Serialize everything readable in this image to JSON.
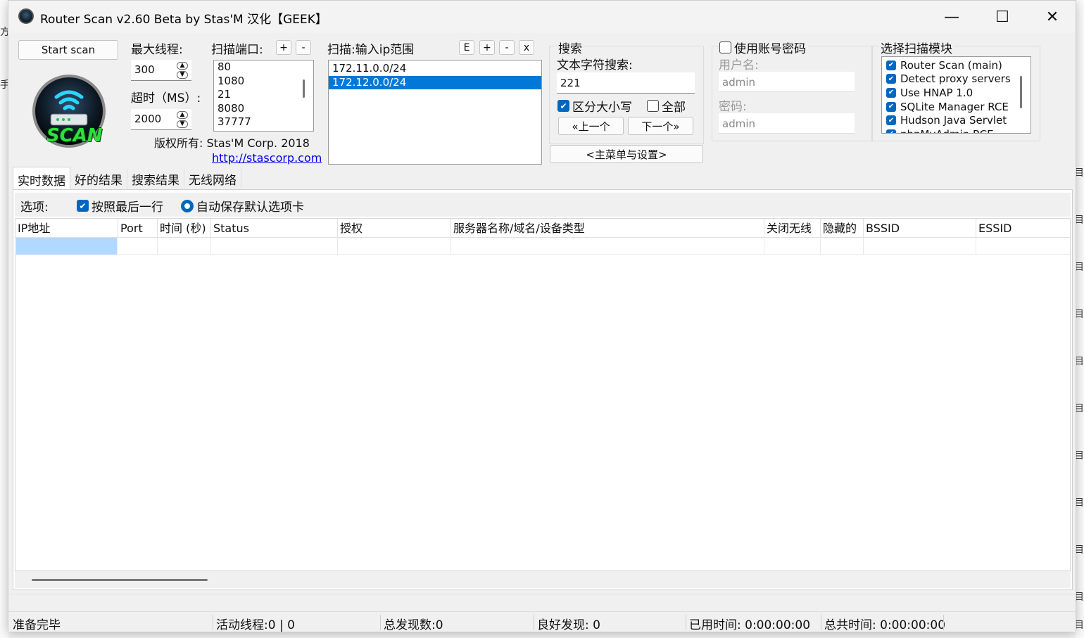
{
  "window": {
    "title": "Router Scan v2.60 Beta by Stas'M  汉化【GEEK】",
    "minimize_glyph": "—",
    "maximize_glyph": "☐",
    "close_glyph": "✕"
  },
  "background": {
    "left_glyphs": [
      "方",
      "手"
    ],
    "right_glyphs": [
      "目",
      "目",
      "目",
      "目",
      "目",
      "目",
      "目",
      "目",
      "目",
      "目",
      "目"
    ]
  },
  "controls": {
    "start_scan": "Start scan",
    "max_threads_label": "最大线程:",
    "max_threads_value": "300",
    "timeout_label": "超时（MS）:",
    "timeout_value": "2000",
    "copyright": "版权所有: Stas'M Corp. 2018",
    "website": "http://stascorp.com",
    "logo_text": "SCAN"
  },
  "ports": {
    "label": "扫描端口:",
    "add": "+",
    "remove": "-",
    "items": [
      "80",
      "1080",
      "21",
      "8080",
      "37777"
    ]
  },
  "ranges": {
    "label": "扫描:输入ip范围",
    "btn_e": "E",
    "btn_add": "+",
    "btn_remove": "-",
    "btn_clear": "x",
    "items": [
      "172.11.0.0/24",
      "172.12.0.0/24"
    ],
    "selected_index": 1
  },
  "search": {
    "group_label": "搜索",
    "text_label": "文本字符搜索:",
    "value": "221",
    "case_sensitive": "区分大小写",
    "case_sensitive_checked": true,
    "all": "全部",
    "all_checked": false,
    "prev": "«上一个",
    "next": "下一个»",
    "main_menu": "<主菜单与设置>"
  },
  "credentials": {
    "use_label": "使用账号密码",
    "use_checked": false,
    "username_label": "用户名:",
    "username_value": "admin",
    "password_label": "密码:",
    "password_value": "admin"
  },
  "modules": {
    "label": "选择扫描模块",
    "items": [
      {
        "label": "Router Scan (main)",
        "checked": true
      },
      {
        "label": "Detect proxy servers",
        "checked": true
      },
      {
        "label": "Use HNAP 1.0",
        "checked": true
      },
      {
        "label": "SQLite Manager RCE",
        "checked": true
      },
      {
        "label": "Hudson Java Servlet",
        "checked": true
      },
      {
        "label": "phpMyAdmin RCE",
        "checked": true
      }
    ]
  },
  "tabs": [
    "实时数据",
    "好的结果",
    "搜索结果",
    "无线网络"
  ],
  "active_tab": 0,
  "options": {
    "label": "选项:",
    "follow_last": "按照最后一行",
    "follow_last_checked": true,
    "autosave": "自动保存默认选项卡",
    "autosave_selected": true
  },
  "table": {
    "columns": [
      "IP地址",
      "Port",
      "时间 (秒)",
      "Status",
      "授权",
      "服务器名称/域名/设备类型",
      "关闭无线",
      "隐藏的",
      "BSSID",
      "ESSID"
    ],
    "rows": [
      [
        "",
        "",
        "",
        "",
        "",
        "",
        "",
        "",
        "",
        ""
      ]
    ]
  },
  "status": {
    "state": "准备完毕",
    "active_threads": "活动线程:0 | 0",
    "total_found": "总发现数:0",
    "good_found": "良好发现:  0",
    "elapsed": "已用时间: 0:00:00:00",
    "total_time": "总共时间: 0:00:00:00"
  },
  "colors": {
    "accent": "#0078d7",
    "checkbox": "#0067c0",
    "selection_cell": "#b1d8ff",
    "link": "#0000ee"
  }
}
